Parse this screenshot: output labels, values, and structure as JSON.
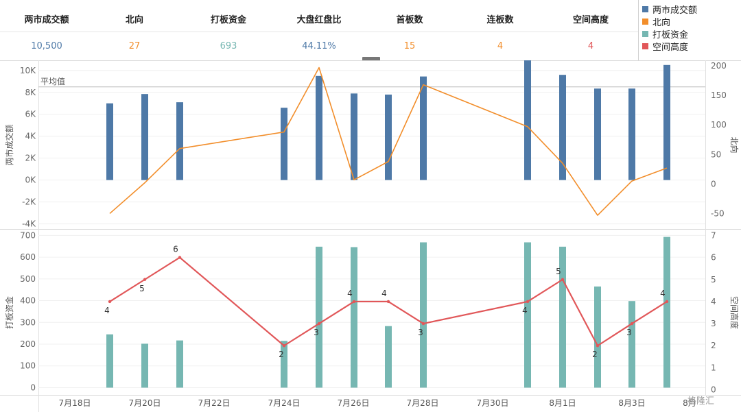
{
  "stats": [
    {
      "label": "两市成交额",
      "value": "10,500",
      "color": "#4e79a7"
    },
    {
      "label": "北向",
      "value": "27",
      "color": "#f28e2b"
    },
    {
      "label": "打板资金",
      "value": "693",
      "color": "#76b7b2"
    },
    {
      "label": "大盘红盘比",
      "value": "44.11%",
      "color": "#4e79a7"
    },
    {
      "label": "首板数",
      "value": "15",
      "color": "#f28e2b"
    },
    {
      "label": "连板数",
      "value": "4",
      "color": "#f28e2b"
    },
    {
      "label": "空间高度",
      "value": "4",
      "color": "#e15759"
    }
  ],
  "legend": [
    {
      "label": "两市成交额",
      "color": "#4e79a7"
    },
    {
      "label": "北向",
      "color": "#f28e2b"
    },
    {
      "label": "打板资金",
      "color": "#76b7b2"
    },
    {
      "label": "空间高度",
      "color": "#e15759"
    }
  ],
  "watermark": "格隆汇",
  "chart_data": {
    "type": "bar",
    "x_ticks": [
      "7月18日",
      "7月20日",
      "7月22日",
      "7月24日",
      "7月26日",
      "7月28日",
      "7月30日",
      "8月1日",
      "8月3日",
      "8月"
    ],
    "dates": [
      "7月19日",
      "7月20日",
      "7月21日",
      "7月24日",
      "7月25日",
      "7月26日",
      "7月27日",
      "7月28日",
      "7月31日",
      "8月1日",
      "8月2日",
      "8月3日",
      "8月4日"
    ],
    "top_panel": {
      "left_axis_label": "两市成交额",
      "right_axis_label": "北向",
      "left_ticks": [
        "-4K",
        "-2K",
        "0K",
        "2K",
        "4K",
        "6K",
        "8K",
        "10K"
      ],
      "right_ticks": [
        "-50",
        "0",
        "50",
        "100",
        "150",
        "200"
      ],
      "left_ylim": [
        -4400,
        10800
      ],
      "right_ylim": [
        -75,
        207
      ],
      "reference_line": {
        "label": "平均值",
        "value": 8500
      },
      "bars": {
        "name": "两市成交额",
        "values": [
          7000,
          7850,
          7100,
          6600,
          9500,
          7900,
          7800,
          9450,
          11100,
          9600,
          8350,
          8350,
          10500
        ]
      },
      "line": {
        "name": "北向",
        "values": [
          -50,
          2,
          60,
          88,
          197,
          7,
          38,
          168,
          97,
          35,
          -53,
          5,
          27
        ]
      }
    },
    "bottom_panel": {
      "left_axis_label": "打板资金",
      "right_axis_label": "空间高度",
      "left_ticks": [
        "0",
        "100",
        "200",
        "300",
        "400",
        "500",
        "600",
        "700"
      ],
      "right_ticks": [
        "0",
        "1",
        "2",
        "3",
        "4",
        "5",
        "6",
        "7"
      ],
      "left_ylim": [
        -30,
        720
      ],
      "right_ylim": [
        -0.2,
        7.2
      ],
      "bars": {
        "name": "打板资金",
        "values": [
          245,
          202,
          217,
          215,
          648,
          646,
          283,
          668,
          668,
          648,
          465,
          398,
          693
        ]
      },
      "line": {
        "name": "空间高度",
        "values": [
          4,
          5,
          6,
          2,
          3,
          4,
          4,
          3,
          4,
          5,
          2,
          3,
          4
        ]
      },
      "line_labels": [
        "4",
        "5",
        "6",
        "2",
        "3",
        "4",
        "4",
        "3",
        "4",
        "5",
        "2",
        "3",
        "4"
      ]
    }
  }
}
